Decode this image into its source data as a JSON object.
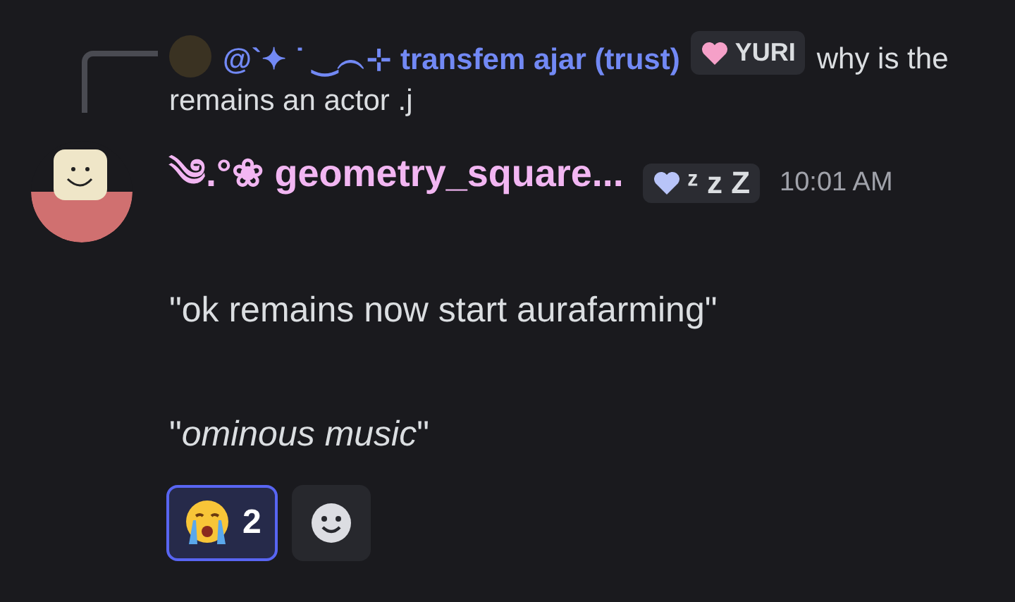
{
  "reply": {
    "author": "@`✦ ˙ ‿︵⊹ transfem ajar (trust)",
    "tag": "YURI",
    "text_lines": [
      "why is the",
      "remains an actor .j"
    ]
  },
  "message": {
    "author": "༄.°❀ geometry_square...",
    "tag": "ᶻ z Z",
    "time": "10:01 AM",
    "paragraphs": [
      "\"ok remains now start aurafarming\"",
      "\"*ominous music*\""
    ]
  },
  "reactions": [
    {
      "count": "2",
      "selected": true
    }
  ]
}
